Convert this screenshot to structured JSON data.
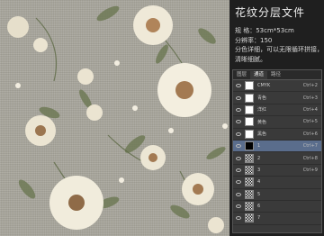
{
  "title": "花纹分层文件",
  "info": {
    "line1": "规 格：53cm*53cm",
    "line2": "分辨率：150",
    "line3": "分色详细，可以无限循环拼接，",
    "line4": "清晰细腻。"
  },
  "tabs": [
    "图层",
    "通道",
    "路径"
  ],
  "layers": [
    {
      "name": "CMYK",
      "shortcut": "Ctrl+2",
      "thumb": "white"
    },
    {
      "name": "青色",
      "shortcut": "Ctrl+3",
      "thumb": "white"
    },
    {
      "name": "洋红",
      "shortcut": "Ctrl+4",
      "thumb": "white"
    },
    {
      "name": "黄色",
      "shortcut": "Ctrl+5",
      "thumb": "white"
    },
    {
      "name": "黑色",
      "shortcut": "Ctrl+6",
      "thumb": "white"
    },
    {
      "name": "1",
      "shortcut": "Ctrl+7",
      "thumb": "black"
    },
    {
      "name": "2",
      "shortcut": "Ctrl+8",
      "thumb": "noise"
    },
    {
      "name": "3",
      "shortcut": "Ctrl+9",
      "thumb": "noise"
    },
    {
      "name": "4",
      "shortcut": "",
      "thumb": "noise"
    },
    {
      "name": "5",
      "shortcut": "",
      "thumb": "noise"
    },
    {
      "name": "6",
      "shortcut": "",
      "thumb": "noise"
    },
    {
      "name": "7",
      "shortcut": "",
      "thumb": "noise"
    }
  ],
  "colors": {
    "background": "#a8a69c",
    "panel": "#1f1f1f",
    "selected_row": "#5a6d8c",
    "flower": "#efe9d8",
    "leaf": "#6f7a56"
  }
}
